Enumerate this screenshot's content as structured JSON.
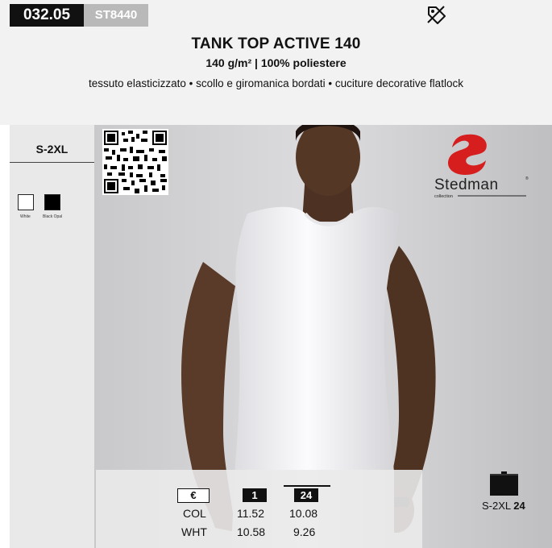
{
  "header": {
    "code": "032.05",
    "sku": "ST8440",
    "title": "TANK TOP ACTIVE 140",
    "subtitle": "140 g/m² | 100% poliestere",
    "features": "tessuto elasticizzato • scollo e giromanica bordati • cuciture decorative flatlock",
    "icon": "price-tag-icon"
  },
  "sidebar": {
    "sizes": "S-2XL",
    "colors": [
      {
        "name": "White",
        "hex": "#ffffff"
      },
      {
        "name": "Black Opal",
        "hex": "#000000"
      }
    ]
  },
  "brand": {
    "name": "Stedman",
    "subline": "collection",
    "accent": "#d61e1e"
  },
  "prices": {
    "currency": "€",
    "qty_headers": [
      "1",
      "24"
    ],
    "rows": [
      {
        "label": "COL",
        "values": [
          "11.52",
          "10.08"
        ]
      },
      {
        "label": "WHT",
        "values": [
          "10.58",
          "9.26"
        ]
      }
    ]
  },
  "packaging": {
    "icon": "box-icon",
    "sizes": "S-2XL",
    "quantity": "24"
  }
}
